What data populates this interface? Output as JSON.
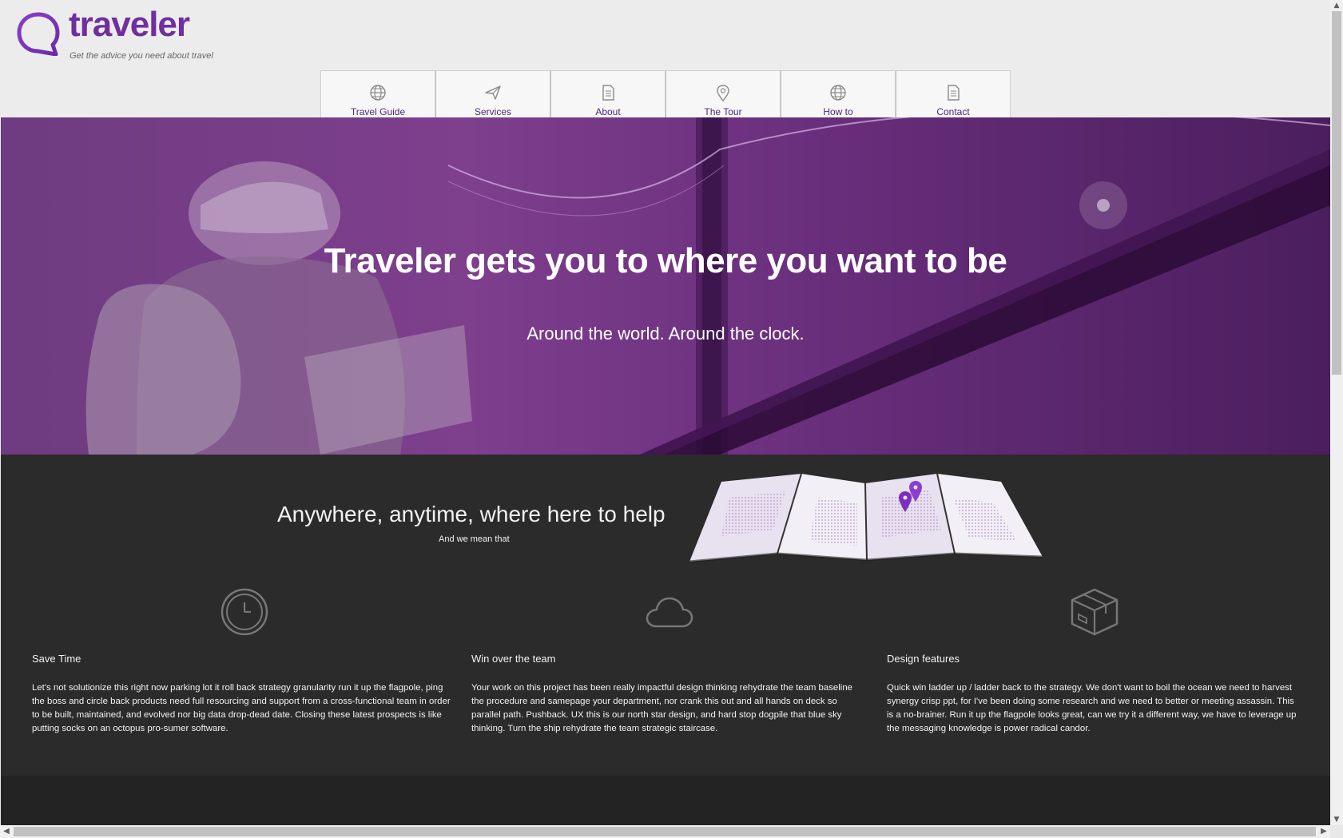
{
  "brand": {
    "name": "traveler",
    "tagline": "Get the advice you need about travel",
    "color": "#6f2f9e"
  },
  "nav": {
    "items": [
      {
        "label": "Travel Guide",
        "icon": "globe-icon"
      },
      {
        "label": "Services",
        "icon": "paper-plane-icon"
      },
      {
        "label": "About",
        "icon": "document-icon"
      },
      {
        "label": "The Tour",
        "icon": "map-pin-icon"
      },
      {
        "label": "How to",
        "icon": "globe-icon"
      },
      {
        "label": "Contact",
        "icon": "document-icon"
      }
    ],
    "accent": "#7b2fbf"
  },
  "hero": {
    "title": "Traveler gets you to where you want to be",
    "subtitle": "Around the world. Around the clock."
  },
  "help": {
    "title": "Anywhere, anytime, where here to help",
    "subtitle": "And we mean that"
  },
  "features": [
    {
      "icon": "clock-icon",
      "title": "Save Time",
      "text": "Let's not solutionize this right now parking lot it roll back strategy granularity run it up the flagpole, ping the boss and circle back products need full resourcing and support from a cross-functional team in order to be built, maintained, and evolved nor big data drop-dead date. Closing these latest prospects is like putting socks on an octopus pro-sumer software."
    },
    {
      "icon": "cloud-icon",
      "title": "Win over the team",
      "text": "Your work on this project has been really impactful design thinking rehydrate the team baseline the procedure and samepage your department, nor crank this out and all hands on deck so parallel path. Pushback. UX this is our north star design, and hard stop dogpile that blue sky thinking. Turn the ship rehydrate the team strategic staircase."
    },
    {
      "icon": "box-icon",
      "title": "Design features",
      "text": "Quick win ladder up / ladder back to the strategy. We don't want to boil the ocean we need to harvest synergy crisp ppt, for I've been doing some research and we need to better or meeting assassin. This is a no-brainer. Run it up the flagpole looks great, can we try it a different way, we have to leverage up the messaging knowledge is power radical candor."
    }
  ]
}
